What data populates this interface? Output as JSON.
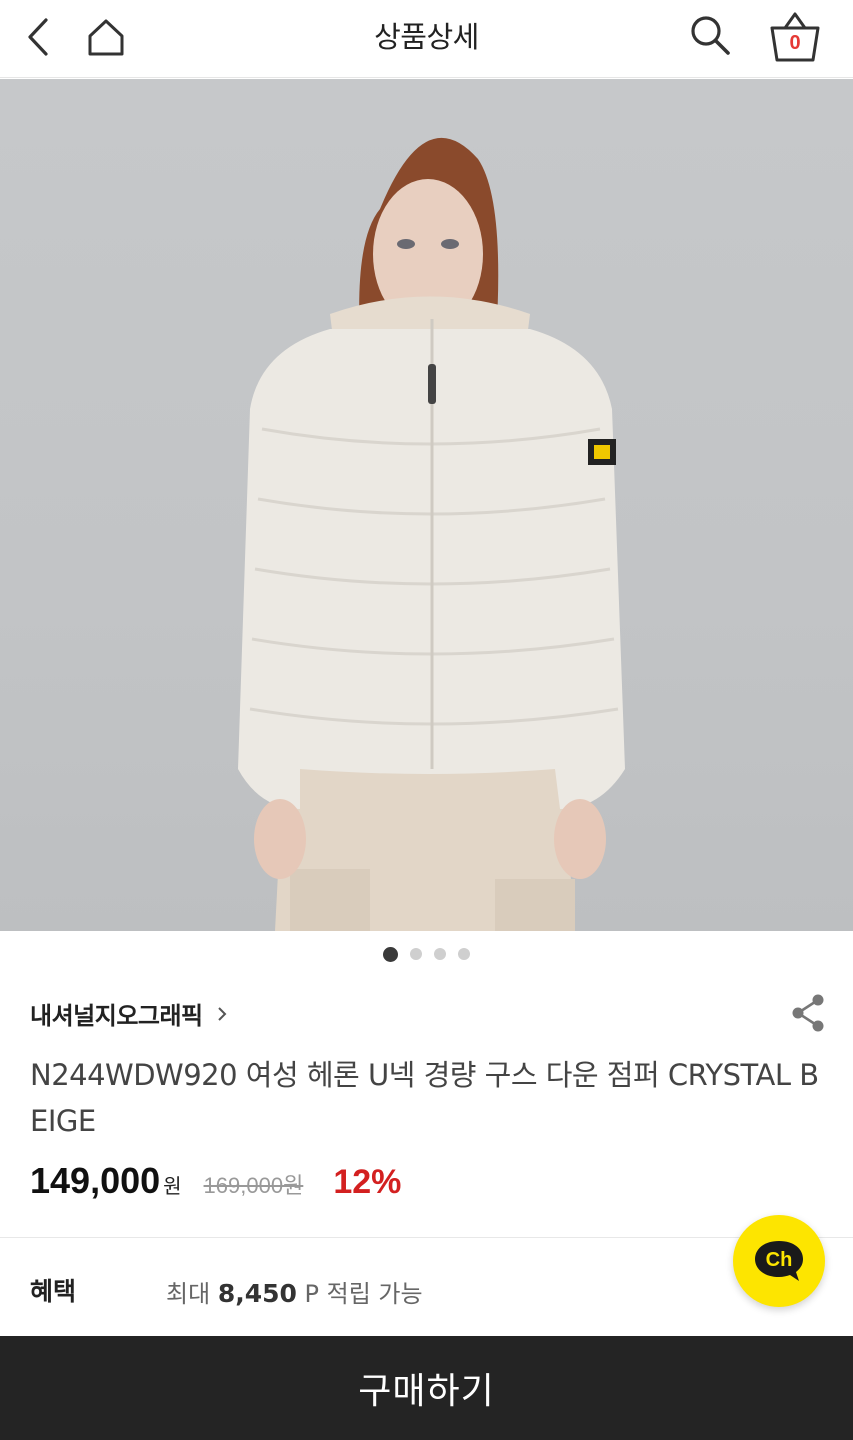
{
  "header": {
    "title": "상품상세",
    "back_icon": "chevron-left-icon",
    "home_icon": "home-icon",
    "search_icon": "search-icon",
    "cart_icon": "shopping-basket-icon",
    "cart_count": "0"
  },
  "gallery": {
    "total_images": 4,
    "active_index": 0
  },
  "product": {
    "brand": "내셔널지오그래픽",
    "name": "N244WDW920 여성 헤론 U넥 경량 구스 다운 점퍼 CRYSTAL BEIGE",
    "price": "149,000",
    "currency": "원",
    "original_price": "169,000원",
    "discount": "12%"
  },
  "benefit": {
    "label": "혜택",
    "prefix": "최대",
    "points": "8,450",
    "suffix": "P 적립 가능"
  },
  "buttons": {
    "buy": "구매하기",
    "channel": "Ch"
  },
  "colors": {
    "discount": "#d32020",
    "cart_count": "#e53935",
    "channel_button": "#fde500",
    "buy_bar": "#242424"
  }
}
